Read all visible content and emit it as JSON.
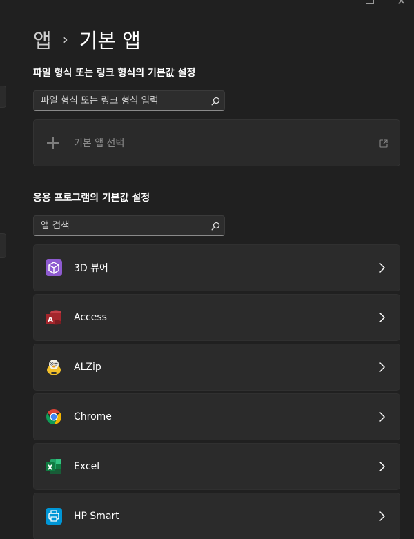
{
  "breadcrumb": {
    "parent": "앱",
    "separator": "›",
    "current": "기본 앱"
  },
  "file_type_section": {
    "title": "파일 형식 또는 링크 형식의 기본값 설정",
    "search_placeholder": "파일 형식 또는 링크 형식 입력",
    "choose_default_label": "기본 앱 선택"
  },
  "apps_section": {
    "title": "응용 프로그램의 기본값 설정",
    "search_placeholder": "앱 검색"
  },
  "apps": [
    {
      "name": "3D 뷰어",
      "icon": "3d-viewer-icon",
      "color": "#8e5bd0"
    },
    {
      "name": "Access",
      "icon": "access-icon",
      "color": "#a4262c",
      "badge": "A"
    },
    {
      "name": "ALZip",
      "icon": "alzip-icon",
      "color": "#f2c029"
    },
    {
      "name": "Chrome",
      "icon": "chrome-icon",
      "color": "#4285f4"
    },
    {
      "name": "Excel",
      "icon": "excel-icon",
      "color": "#1e7145",
      "badge": "X"
    },
    {
      "name": "HP Smart",
      "icon": "hp-smart-icon",
      "color": "#0096d6"
    }
  ],
  "colors": {
    "background": "#202020",
    "card": "#2b2b2b",
    "text": "#ffffff",
    "muted": "#8a8a8a"
  }
}
